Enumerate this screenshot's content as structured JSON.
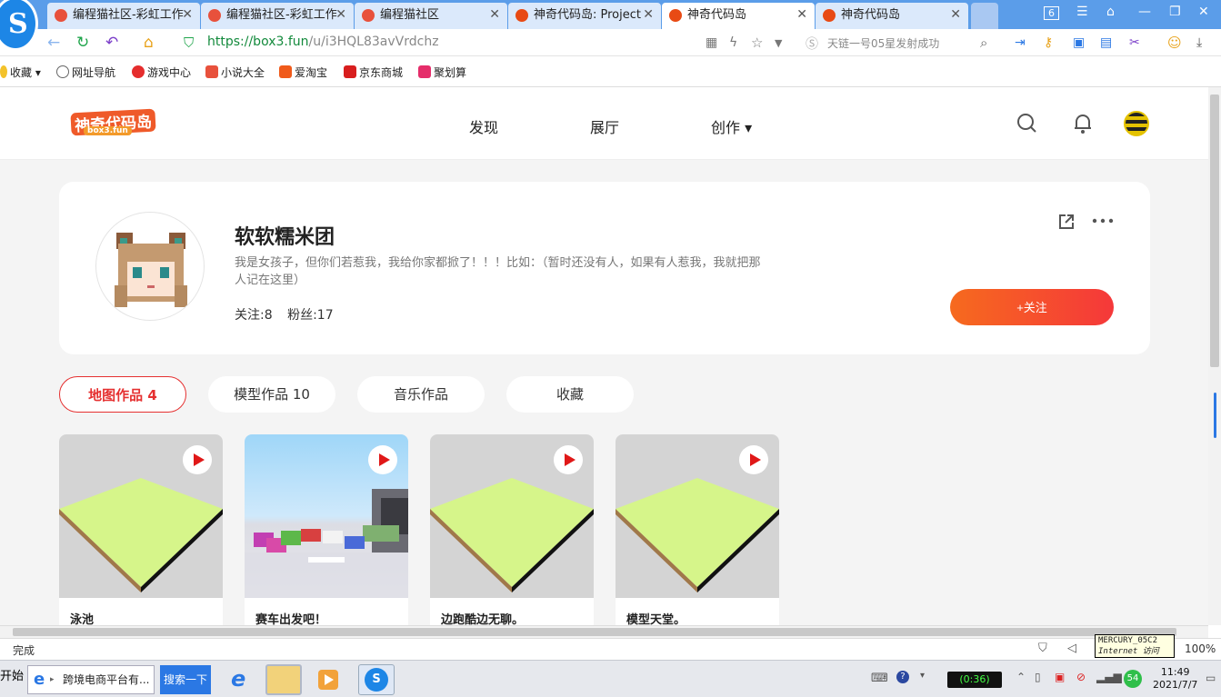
{
  "browser": {
    "tabs": [
      {
        "title": "编程猫社区-彩虹工作"
      },
      {
        "title": "编程猫社区-彩虹工作"
      },
      {
        "title": "编程猫社区"
      },
      {
        "title": "神奇代码岛: Project"
      },
      {
        "title": "神奇代码岛"
      },
      {
        "title": "神奇代码岛"
      }
    ],
    "tab_count": "6",
    "url_host": "https://box3.fun",
    "url_path": "/u/i3HQL83avVrdchz",
    "search_hint": "天链一号05星发射成功",
    "favorites": [
      "收藏",
      "网址导航",
      "游戏中心",
      "小说大全",
      "爱淘宝",
      "京东商城",
      "聚划算"
    ],
    "status": "完成",
    "tooltip_line1": "MERCURY_05C2",
    "tooltip_line2": "Internet 访问",
    "zoom": "100%"
  },
  "site": {
    "logo_main": "神奇代码岛",
    "logo_sub": "box3.fun",
    "nav": [
      "发现",
      "展厅",
      "创作 ▾"
    ]
  },
  "profile": {
    "name": "软软糯米团",
    "bio": "我是女孩子，但你们若惹我，我给你家都掀了！！！比如：（暂时还没有人，如果有人惹我，我就把那人记在这里）",
    "following": "关注:8",
    "followers": "粉丝:17",
    "follow_button": "+关注"
  },
  "tabs": [
    {
      "label": "地图作品 4"
    },
    {
      "label": "模型作品 10"
    },
    {
      "label": "音乐作品"
    },
    {
      "label": "收藏"
    }
  ],
  "works": [
    {
      "title": "泳池"
    },
    {
      "title": "赛车出发吧！"
    },
    {
      "title": "边跑酷边无聊。"
    },
    {
      "title": "模型天堂。"
    }
  ],
  "taskbar": {
    "start": "开始",
    "ie_task": "跨境电商平台有...",
    "search_task": "搜索一下",
    "battery": "(0:36)",
    "badge": "54",
    "time": "11:49",
    "date": "2021/7/7"
  }
}
